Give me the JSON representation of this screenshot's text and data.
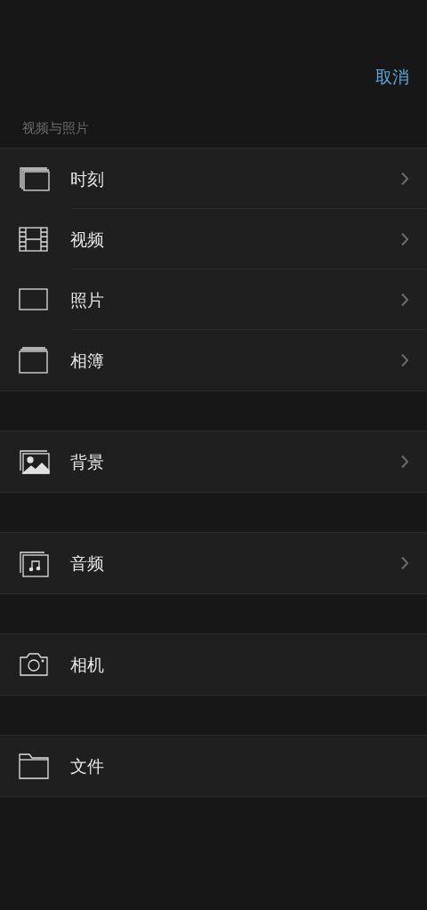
{
  "cancel_button": "取消",
  "section_title": "视频与照片",
  "groups": [
    {
      "items": [
        {
          "kind": "moments",
          "label": "时刻",
          "chevron": true
        },
        {
          "kind": "video",
          "label": "视频",
          "chevron": true
        },
        {
          "kind": "photo",
          "label": "照片",
          "chevron": true
        },
        {
          "kind": "album",
          "label": "相簿",
          "chevron": true
        }
      ]
    },
    {
      "items": [
        {
          "kind": "background",
          "label": "背景",
          "chevron": true
        }
      ]
    },
    {
      "items": [
        {
          "kind": "audio",
          "label": "音频",
          "chevron": true
        }
      ]
    },
    {
      "items": [
        {
          "kind": "camera",
          "label": "相机",
          "chevron": false
        }
      ]
    },
    {
      "items": [
        {
          "kind": "folder",
          "label": "文件",
          "chevron": false
        }
      ]
    }
  ]
}
